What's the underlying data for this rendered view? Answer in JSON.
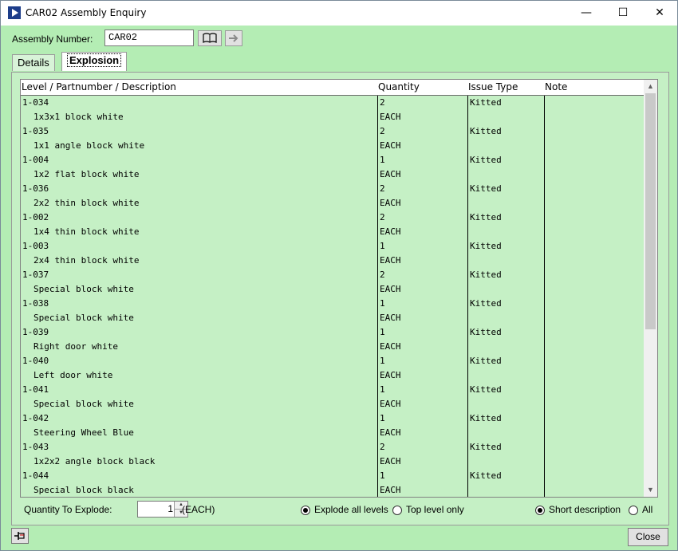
{
  "window": {
    "title": "CAR02 Assembly Enquiry",
    "minimize": "—",
    "maximize": "☐",
    "close": "✕"
  },
  "form": {
    "assembly_label": "Assembly Number:",
    "assembly_value": "CAR02"
  },
  "tabs": [
    {
      "label": "Details"
    },
    {
      "label": "Explosion"
    }
  ],
  "grid": {
    "headers": [
      "Level / Partnumber / Description",
      "Quantity",
      "Issue Type",
      "Note"
    ],
    "rows": [
      {
        "level": "1-034",
        "qty": "2",
        "issue": "Kitted",
        "desc": "1x3x1 block white",
        "unit": "EACH"
      },
      {
        "level": "1-035",
        "qty": "2",
        "issue": "Kitted",
        "desc": "1x1 angle block white",
        "unit": "EACH"
      },
      {
        "level": "1-004",
        "qty": "1",
        "issue": "Kitted",
        "desc": "1x2 flat block white",
        "unit": "EACH"
      },
      {
        "level": "1-036",
        "qty": "2",
        "issue": "Kitted",
        "desc": "2x2 thin block white",
        "unit": "EACH"
      },
      {
        "level": "1-002",
        "qty": "2",
        "issue": "Kitted",
        "desc": "1x4 thin block white",
        "unit": "EACH"
      },
      {
        "level": "1-003",
        "qty": "1",
        "issue": "Kitted",
        "desc": "2x4 thin block white",
        "unit": "EACH"
      },
      {
        "level": "1-037",
        "qty": "2",
        "issue": "Kitted",
        "desc": "Special block white",
        "unit": "EACH"
      },
      {
        "level": "1-038",
        "qty": "1",
        "issue": "Kitted",
        "desc": "Special block white",
        "unit": "EACH"
      },
      {
        "level": "1-039",
        "qty": "1",
        "issue": "Kitted",
        "desc": "Right door white",
        "unit": "EACH"
      },
      {
        "level": "1-040",
        "qty": "1",
        "issue": "Kitted",
        "desc": "Left door white",
        "unit": "EACH"
      },
      {
        "level": "1-041",
        "qty": "1",
        "issue": "Kitted",
        "desc": "Special block white",
        "unit": "EACH"
      },
      {
        "level": "1-042",
        "qty": "1",
        "issue": "Kitted",
        "desc": "Steering Wheel Blue",
        "unit": "EACH"
      },
      {
        "level": "1-043",
        "qty": "2",
        "issue": "Kitted",
        "desc": "1x2x2 angle block black",
        "unit": "EACH"
      },
      {
        "level": "1-044",
        "qty": "1",
        "issue": "Kitted",
        "desc": "Special block black",
        "unit": "EACH"
      }
    ]
  },
  "bottom": {
    "qty_label": "Quantity To Explode:",
    "qty_value": "1",
    "unit": "(EACH)",
    "explode_all": "Explode all levels",
    "top_level": "Top level only",
    "short_desc": "Short description",
    "all": "All"
  },
  "footer": {
    "close": "Close"
  },
  "colors": {
    "panel": "#c5f0c5",
    "window_bg": "#b4edb4",
    "title_bg": "#ffffff"
  }
}
